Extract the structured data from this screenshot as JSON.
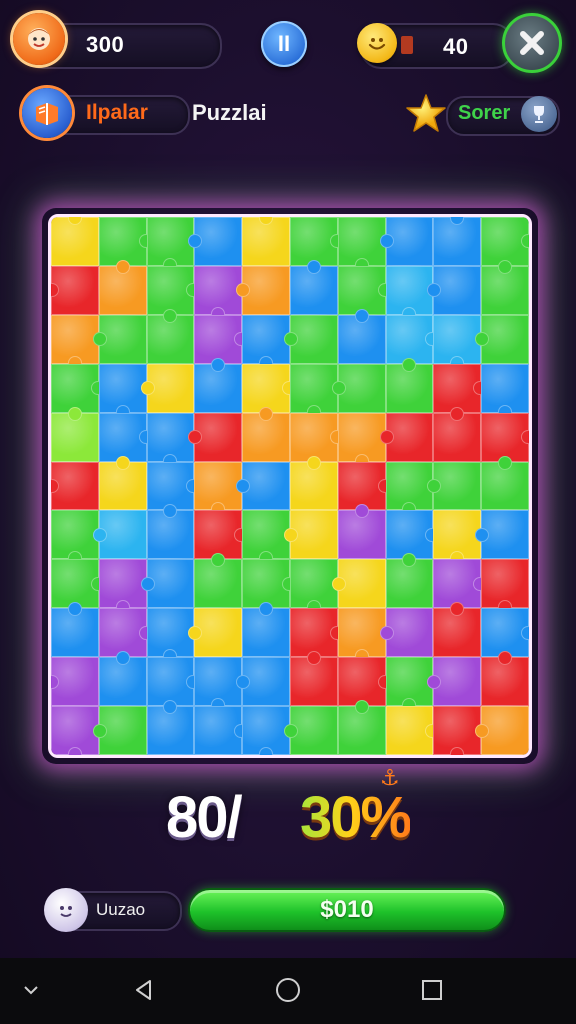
{
  "hud": {
    "coins": "300",
    "pause_label": "II",
    "score": "40",
    "mode_label": "Ilpalar",
    "title": "Puzzlai",
    "sort_label": "Sorer"
  },
  "board": {
    "columns": 10,
    "rows": 11,
    "colors": {
      "g": "#3fd23a",
      "b": "#1e90f0",
      "y": "#f5d61c",
      "o": "#f79a22",
      "r": "#e8262a",
      "p": "#a04ad8",
      "l": "#8ce83a",
      "c": "#2cb4f0"
    },
    "grid": [
      "yggbyggbbg",
      "rogpobgcbg",
      "oggpbgbccg",
      "gbybygggrb",
      "lbbrooorrr",
      "rybobyrggg",
      "gcbrgypbyb",
      "gpbgggygpr",
      "bpbybroprb",
      "pbbbbrrgpr",
      "pgbbbggyro"
    ]
  },
  "progress": {
    "left": "80/",
    "right": "30%",
    "anchor": "⚓"
  },
  "footer": {
    "hint_label": "Uuzao",
    "buy_label": "$010"
  }
}
